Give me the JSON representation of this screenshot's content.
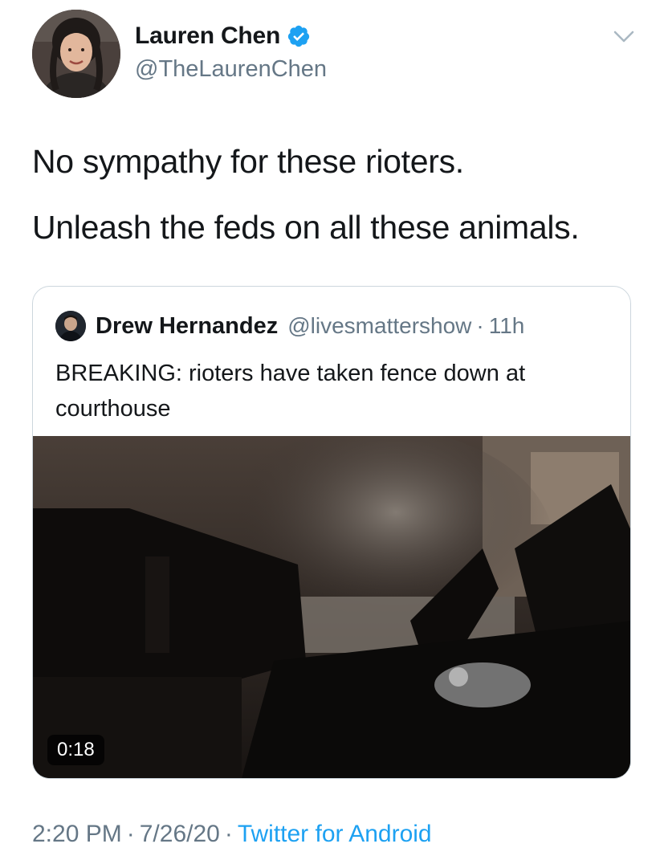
{
  "author": {
    "display_name": "Lauren Chen",
    "handle": "@TheLaurenChen",
    "verified": true,
    "verified_icon": "verified-badge-icon",
    "verified_color": "#1da1f2"
  },
  "menu_icon": "chevron-down-icon",
  "tweet_text": {
    "line1": "No sympathy for these rioters.",
    "line2": "Unleash the feds on all these animals."
  },
  "quoted_tweet": {
    "display_name": "Drew Hernandez",
    "handle": "@livesmattershow",
    "separator": "·",
    "time": "11h",
    "text": "BREAKING: rioters have taken fence down at courthouse",
    "media": {
      "type": "video",
      "duration": "0:18"
    }
  },
  "footer": {
    "time": "2:20 PM",
    "separator": "·",
    "date": "7/26/20",
    "source": "Twitter for Android"
  },
  "colors": {
    "text_primary": "#14171a",
    "text_secondary": "#657786",
    "link": "#1da1f2",
    "border": "#ccd6dd"
  }
}
